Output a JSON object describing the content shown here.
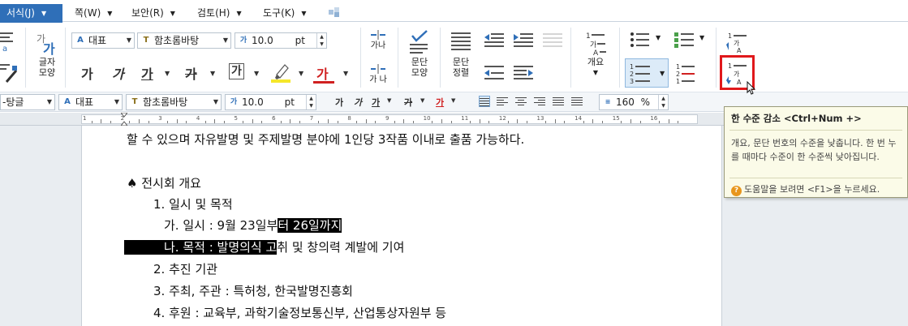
{
  "menu": {
    "tabs": [
      {
        "label": "서식(J)",
        "active": true
      },
      {
        "label": "쪽(W)",
        "active": false
      },
      {
        "label": "보안(R)",
        "active": false
      },
      {
        "label": "검토(H)",
        "active": false
      },
      {
        "label": "도구(K)",
        "active": false
      }
    ]
  },
  "ribbon": {
    "char_shape_label_1": "글자",
    "char_shape_label_2": "모양",
    "style_combo": "대표",
    "font_combo": "함초롬바탕",
    "size_combo": "10.0",
    "size_unit": "pt",
    "fmt_bold": "가",
    "fmt_italic": "가",
    "fmt_underline": "가",
    "fmt_strike": "가",
    "fmt_outline": "가",
    "fmt_color": "가",
    "spacing_top": "가나",
    "spacing_bottom": "가 나",
    "para_shape_label_1": "문단",
    "para_shape_label_2": "모양",
    "para_sort_label_1": "문단",
    "para_sort_label_2": "정렬",
    "outline_label": "개요",
    "highlight_color": "#f5e72a",
    "font_color": "#d02020"
  },
  "toolbar2": {
    "style_combo": "-탕글",
    "style2_combo": "대표",
    "font_combo": "함초롬바탕",
    "size_combo": "10.0",
    "size_unit": "pt",
    "btn_bold": "가",
    "btn_italic": "가",
    "btn_underline": "가",
    "btn_strike": "가",
    "btn_color": "가",
    "line_spacing": "160",
    "line_spacing_unit": "%"
  },
  "ruler": {
    "numbers": [
      "1",
      "2",
      "3",
      "4",
      "5",
      "6",
      "7",
      "8",
      "9",
      "10",
      "11",
      "12",
      "13",
      "14",
      "15",
      "16"
    ]
  },
  "document": {
    "line1": "할 수 있으며 자유발명 및 주제발명 분야에 1인당 3작품 이내로 출품 가능하다.",
    "line2": "♠ 전시회 개요",
    "line3": "1. 일시 및 목적",
    "line4_pre": "가. 일시 : 9월 23일부",
    "line4_sel": "터 26일까지",
    "line5_sel": "    나. 목적 : 발명의식 고",
    "line5_post": "취 및 창의력 계발에 기여",
    "line6": "2. 추진 기관",
    "line7": "3. 주최, 주관 : 특허청, 한국발명진흥회",
    "line8": "4. 후원 : 교육부, 과학기술정보통신부, 산업통상자원부 등"
  },
  "tooltip": {
    "title": "한 수준 감소 <Ctrl+Num +>",
    "body": "개요, 문단 번호의 수준을 낮춥니다. 한 번 누를 때마다 수준이 한 수준씩 낮아집니다.",
    "help": "도움말을 보려면 <F1>을 누르세요."
  },
  "accent_color": "#2f6fb8",
  "highlight_box_color": "#e0181b"
}
